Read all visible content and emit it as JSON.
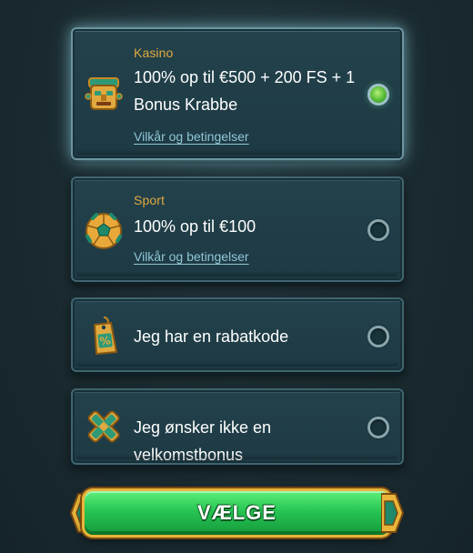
{
  "options": [
    {
      "category": "Kasino",
      "title": "100% op til €500 + 200 FS + 1 Bonus Krabbe",
      "terms": "Vilkår og betingelser",
      "icon": "aztec-mask-icon",
      "selected": true
    },
    {
      "category": "Sport",
      "title": "100% op til €100",
      "terms": "Vilkår og betingelser",
      "icon": "football-icon",
      "selected": false
    },
    {
      "title": "Jeg har en rabatkode",
      "icon": "discount-tag-icon",
      "selected": false
    },
    {
      "title": "Jeg ønsker ikke en velkomstbonus",
      "icon": "no-bonus-cross-icon",
      "selected": false
    }
  ],
  "button": {
    "label": "VÆLGE"
  },
  "colors": {
    "category": "#e0a93f",
    "link": "#8fc6d6",
    "card": "#1f3d47",
    "button": "#27c553",
    "button_border": "#e8b53a"
  }
}
